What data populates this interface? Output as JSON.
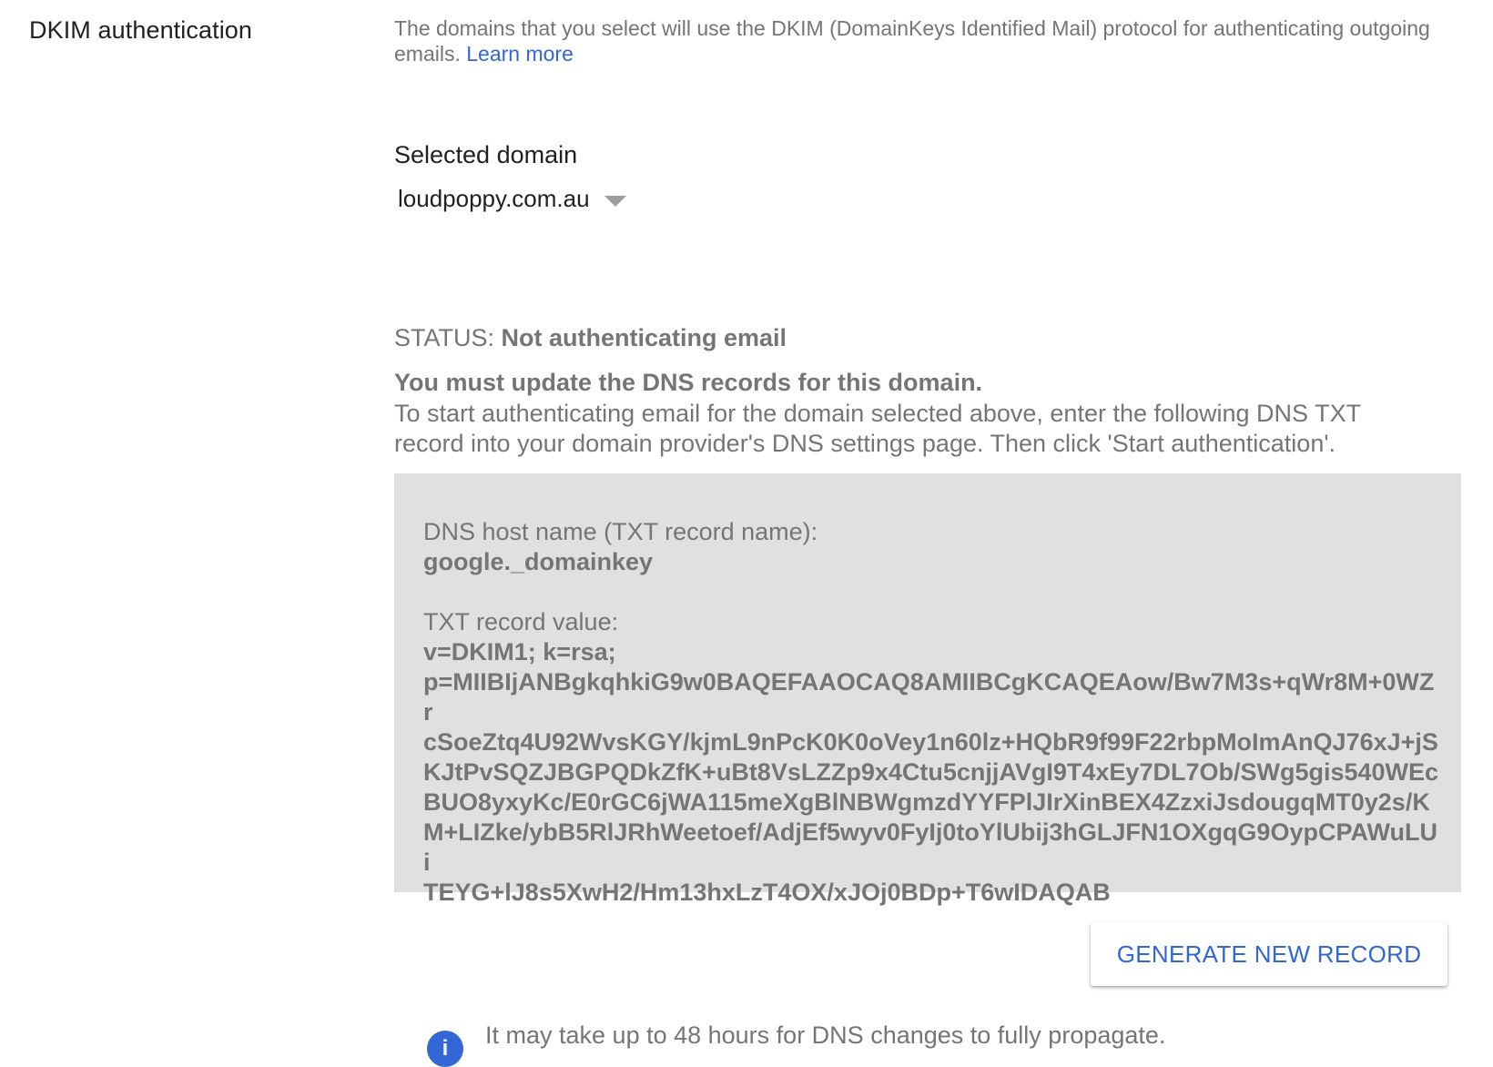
{
  "section": {
    "title": "DKIM authentication"
  },
  "description": {
    "text": "The domains that you select will use the DKIM (DomainKeys Identified Mail) protocol for authenticating outgoing emails.",
    "learn_more": "Learn more"
  },
  "domain": {
    "label": "Selected domain",
    "value": "loudpoppy.com.au"
  },
  "status": {
    "prefix": "STATUS:",
    "value": "Not authenticating email"
  },
  "dns": {
    "warning_title": "You must update the DNS records for this domain.",
    "instructions": "To start authenticating email for the domain selected above, enter the following DNS TXT record into your domain provider's DNS settings page. Then click 'Start authentication'."
  },
  "record": {
    "host_label": "DNS host name (TXT record name):",
    "host_value": "google._domainkey",
    "txt_label": "TXT record value:",
    "txt_value": "v=DKIM1; k=rsa;\np=MIIBIjANBgkqhkiG9w0BAQEFAAOCAQ8AMIIBCgKCAQEAow/Bw7M3s+qWr8M+0WZr\ncSoeZtq4U92WvsKGY/kjmL9nPcK0K0oVey1n60lz+HQbR9f99F22rbpMoImAnQJ76xJ+jS\nKJtPvSQZJBGPQDkZfK+uBt8VsLZZp9x4Ctu5cnjjAVgI9T4xEy7DL7Ob/SWg5gis540WEc\nBUO8yxyKc/E0rGC6jWA115meXgBlNBWgmzdYYFPlJIrXinBEX4ZzxiJsdougqMT0y2s/K\nM+LIZke/ybB5RlJRhWeetoef/AdjEf5wyv0FyIj0toYlUbij3hGLJFN1OXgqG9OypCPAWuLUi\nTEYG+lJ8s5XwH2/Hm13hxLzT4OX/xJOj0BDp+T6wIDAQAB"
  },
  "button": {
    "generate_label": "GENERATE NEW RECORD"
  },
  "info": {
    "icon": "info-icon",
    "text": "It may take up to 48 hours for DNS changes to fully propagate."
  }
}
